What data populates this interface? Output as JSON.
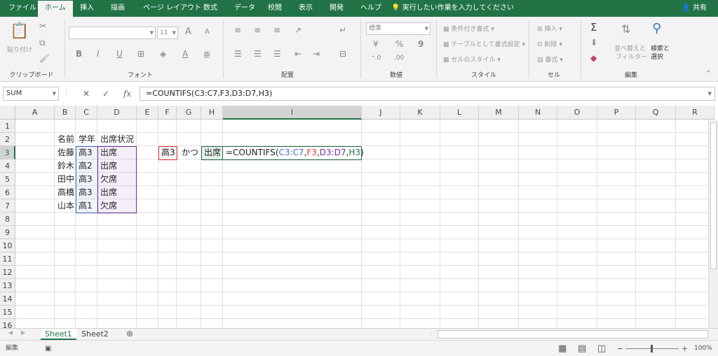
{
  "tabs": [
    "ファイル",
    "ホーム",
    "挿入",
    "描画",
    "ページ レイアウト",
    "数式",
    "データ",
    "校閲",
    "表示",
    "開発",
    "ヘルプ"
  ],
  "tell_me": "実行したい作業を入力してください",
  "share": "共有",
  "ribbon": {
    "clipboard": {
      "label": "クリップボード",
      "paste": "貼り付け"
    },
    "font": {
      "label": "フォント",
      "size": "11",
      "bold": "B",
      "italic": "I",
      "underline": "U",
      "grow": "A",
      "shrink": "A"
    },
    "alignment": {
      "label": "配置"
    },
    "number": {
      "label": "数値",
      "format": "標準",
      "percent": "%",
      "comma": "9"
    },
    "styles": {
      "label": "スタイル",
      "conditional": "条件付き書式",
      "table": "テーブルとして書式設定",
      "cell_styles": "セルのスタイル"
    },
    "cells": {
      "label": "セル",
      "insert": "挿入",
      "delete": "削除",
      "format": "書式"
    },
    "editing": {
      "label": "編集",
      "sort_line1": "並べ替えと",
      "sort_line2": "フィルター",
      "find_line1": "検索と",
      "find_line2": "選択"
    }
  },
  "name_box": "SUM",
  "formula": "=COUNTIFS(C3:C7,F3,D3:D7,H3)",
  "columns": [
    "A",
    "B",
    "C",
    "D",
    "E",
    "F",
    "G",
    "H",
    "I",
    "J",
    "K",
    "L",
    "M",
    "N",
    "O",
    "P",
    "Q",
    "R"
  ],
  "rows": [
    "1",
    "2",
    "3",
    "4",
    "5",
    "6",
    "7",
    "8",
    "9",
    "10",
    "11",
    "12",
    "13",
    "14",
    "15",
    "16"
  ],
  "cells": {
    "B2": "名前",
    "C2": "学年",
    "D2": "出席状況",
    "B3": "佐藤",
    "C3": "高3",
    "D3": "出席",
    "B4": "鈴木",
    "C4": "高2",
    "D4": "出席",
    "B5": "田中",
    "C5": "高3",
    "D5": "欠席",
    "B6": "高橋",
    "C6": "高3",
    "D6": "出席",
    "B7": "山本",
    "C7": "高1",
    "D7": "欠席",
    "F3": "高3",
    "G3": "かつ",
    "H3": "出席"
  },
  "cell_formula": {
    "prefix": "=COUNTIFS(",
    "ref1": "C3:C7",
    "ref2": "F3",
    "ref3": "D3:D7",
    "ref4": "H3",
    "comma": ",",
    "close": ")"
  },
  "sheets": [
    "Sheet1",
    "Sheet2"
  ],
  "status": {
    "mode": "編集",
    "zoom": "100%"
  },
  "colors": {
    "accent": "#217346",
    "ref_c": "#4472c4",
    "ref_f": "#e04040",
    "ref_d": "#7030a0"
  }
}
